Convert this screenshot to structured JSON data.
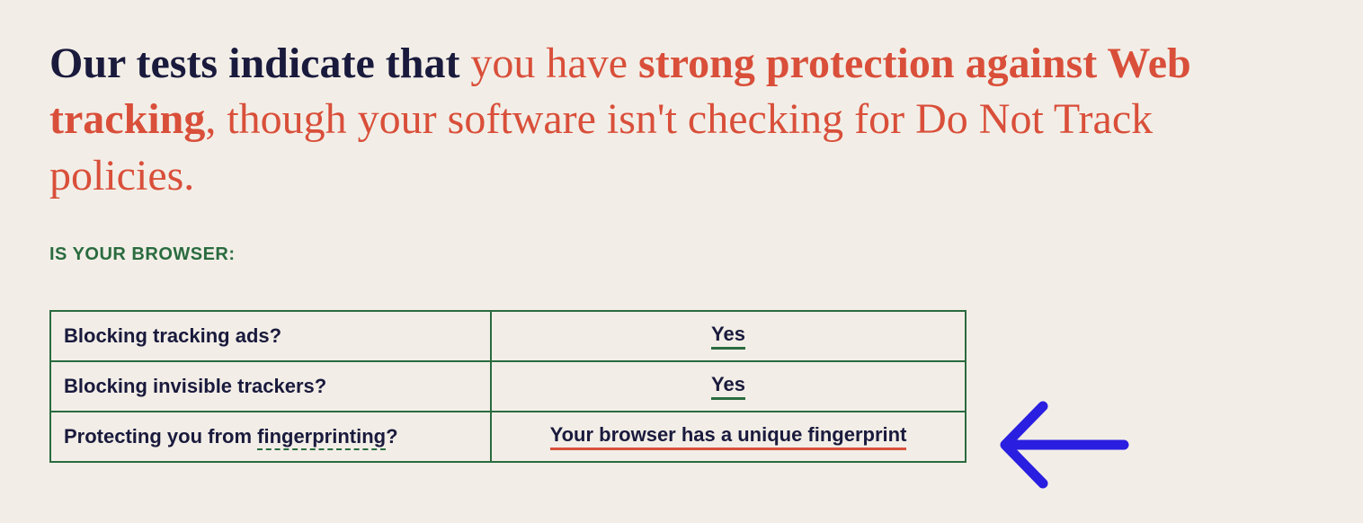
{
  "headline": {
    "lead": "Our tests indicate that ",
    "middle_light": "you have ",
    "strong": "strong protection against Web tracking",
    "tail": ", though your software isn't checking for Do Not Track policies."
  },
  "subheading": "IS YOUR BROWSER:",
  "rows": [
    {
      "label_pre": "Blocking tracking ads?",
      "label_term": "",
      "label_post": "",
      "value": "Yes",
      "value_class": "yes"
    },
    {
      "label_pre": "Blocking invisible trackers?",
      "label_term": "",
      "label_post": "",
      "value": "Yes",
      "value_class": "yes"
    },
    {
      "label_pre": "Protecting you from ",
      "label_term": "fingerprinting",
      "label_post": "?",
      "value": "Your browser has a unique fingerprint",
      "value_class": "unique"
    }
  ]
}
